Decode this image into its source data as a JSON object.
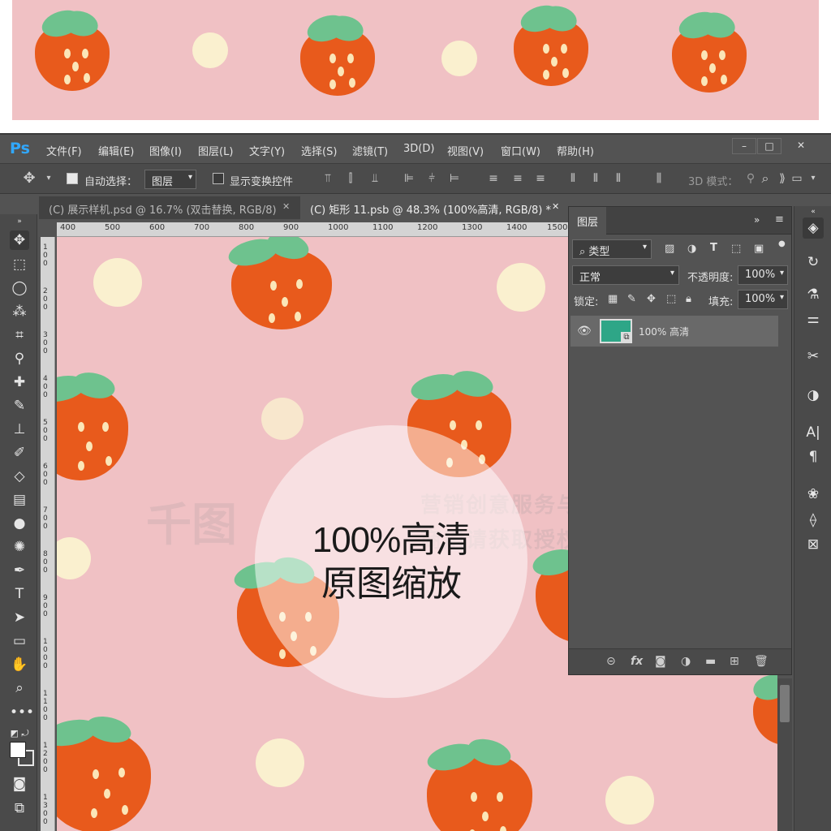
{
  "app": {
    "logo": "Ps"
  },
  "menu": [
    "文件(F)",
    "编辑(E)",
    "图像(I)",
    "图层(L)",
    "文字(Y)",
    "选择(S)",
    "滤镜(T)",
    "3D(D)",
    "视图(V)",
    "窗口(W)",
    "帮助(H)"
  ],
  "window_controls": {
    "minimize": "–",
    "maximize": "□",
    "close": "✕"
  },
  "options_bar": {
    "move_tool_icon": "move-icon",
    "auto_select_label": "自动选择：",
    "auto_select_checked": true,
    "auto_select_target": "图层",
    "show_transform_label": "显示变换控件",
    "show_transform_checked": false,
    "mode_3d_label": "3D 模式："
  },
  "tabs": [
    {
      "label": "(C) 展示样机.psd @ 16.7% (双击替换, RGB/8)",
      "close": "✕",
      "active": false
    },
    {
      "label": "(C) 矩形 11.psb @ 48.3% (100%高清, RGB/8) *",
      "close": "✕",
      "active": true
    }
  ],
  "ruler": {
    "horizontal": [
      "400",
      "500",
      "600",
      "700",
      "800",
      "900",
      "1000",
      "1100",
      "1200",
      "1300",
      "1400",
      "1500"
    ],
    "vertical": [
      "100",
      "200",
      "300",
      "400",
      "500",
      "600",
      "700",
      "800",
      "900",
      "1000",
      "1100",
      "1200",
      "1300"
    ]
  },
  "canvas": {
    "watermark_logo": "千图",
    "watermark_line1": "营销创意服务与协作平台",
    "watermark_line2": "商用请获取授权",
    "badge_line1": "100%高清",
    "badge_line2": "原图缩放"
  },
  "layers_panel": {
    "title": "图层",
    "filter_kind": "类型",
    "blend_mode": "正常",
    "opacity_label": "不透明度:",
    "opacity_value": "100%",
    "lock_label": "锁定:",
    "fill_label": "填充:",
    "fill_value": "100%",
    "layers": [
      {
        "name": "100% 高清",
        "visible": true,
        "thumb_color": "#2ea687"
      }
    ],
    "footer_icons": [
      "link-icon",
      "fx-icon",
      "mask-icon",
      "adjustment-icon",
      "folder-icon",
      "new-layer-icon",
      "trash-icon"
    ]
  },
  "colors": {
    "canvas_bg": "#f0c1c4",
    "strawberry": "#e85a1c",
    "leaf": "#6ec28e",
    "seed": "#fbe6b8",
    "dot": "#faf0cf",
    "ps_blue": "#31a8ff"
  }
}
